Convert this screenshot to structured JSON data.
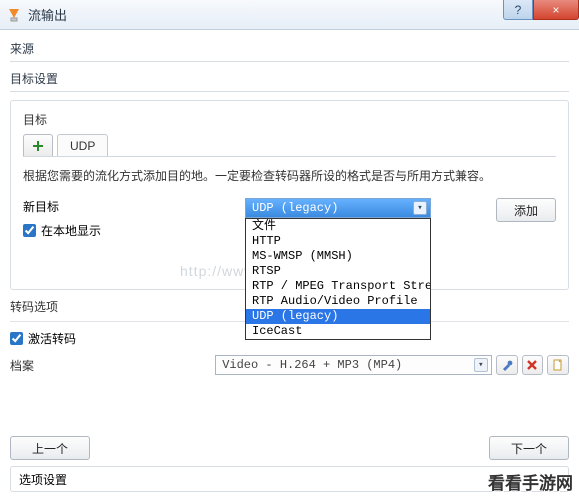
{
  "window": {
    "title": "流输出",
    "help_btn": "?",
    "close_btn": "×"
  },
  "source": {
    "label": "来源"
  },
  "target_settings": {
    "label": "目标设置"
  },
  "dest": {
    "label": "目标",
    "tab_add": "+",
    "tabs": [
      {
        "label": "UDP"
      }
    ],
    "desc": "根据您需要的流化方式添加目的地。一定要检查转码器所设的格式是否与所用方式兼容。",
    "new_target_label": "新目标",
    "select_value": "UDP (legacy)",
    "options": [
      "文件",
      "HTTP",
      "MS-WMSP (MMSH)",
      "RTSP",
      "RTP / MPEG Transport Stream",
      "RTP Audio/Video Profile",
      "UDP (legacy)",
      "IceCast"
    ],
    "selected_index": 6,
    "add_btn": "添加",
    "local_display_label": "在本地显示",
    "local_display_checked": true
  },
  "transcode": {
    "label": "转码选项",
    "activate_label": "激活转码",
    "activate_checked": true,
    "archive_label": "档案",
    "profile_value": "Video - H.264 + MP3 (MP4)",
    "icons": {
      "tool": "tool-icon",
      "delete": "delete-icon",
      "new": "new-icon"
    }
  },
  "watermark": "http://www",
  "footer": {
    "prev": "上一个",
    "next": "下一个"
  },
  "options_section": {
    "label": "选项设置"
  },
  "brand": "看看手游网"
}
